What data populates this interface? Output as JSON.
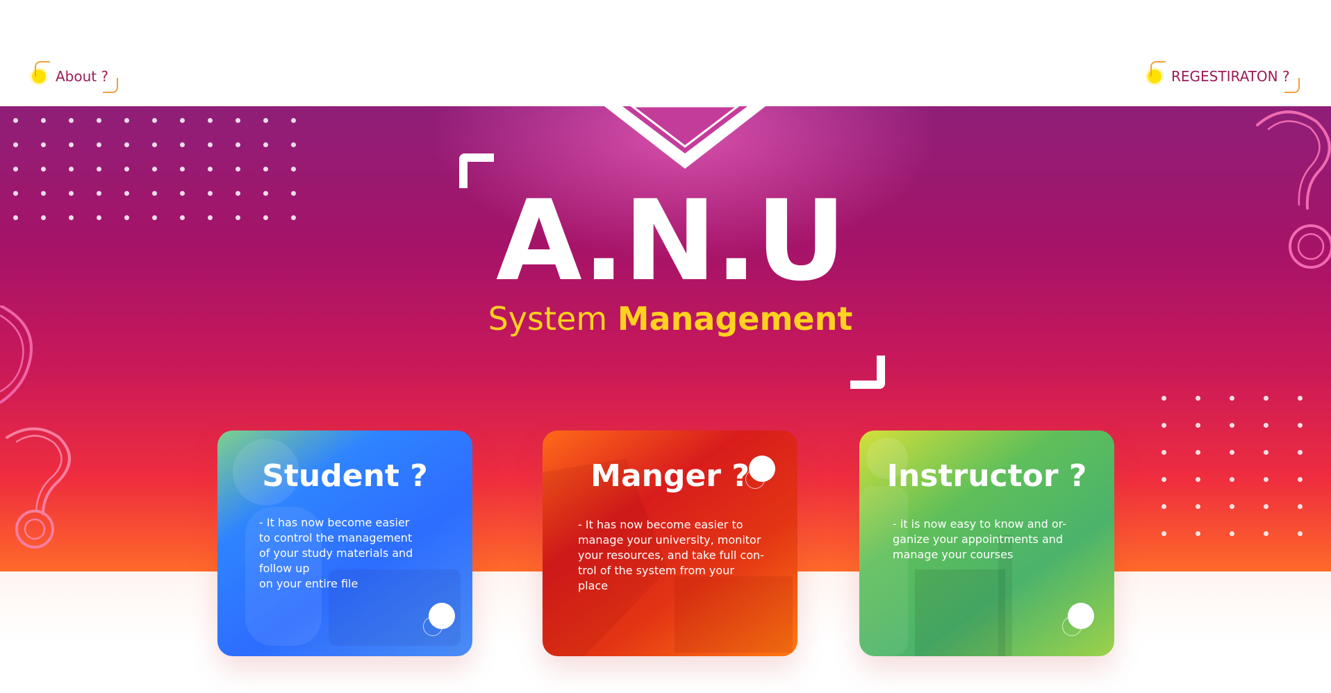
{
  "nav": {
    "about_label": "About ?",
    "registration_label": "REGESTIRATON ?"
  },
  "hero": {
    "title": "A.N.U",
    "subtitle_light": "System ",
    "subtitle_bold": "Management"
  },
  "cards": [
    {
      "title": "Student ?",
      "text": "- It has now become easier\nto control the management\nof your study materials and\nfollow up\non your entire file"
    },
    {
      "title": "Manger ?",
      "text": "- It has now become easier to\nmanage your university, monitor\nyour resources, and take full con-\ntrol of the system from your\nplace"
    },
    {
      "title": "Instructor ?",
      "text": "- it is now easy to know and or-\nganize your appointments and\nmanage your courses"
    }
  ],
  "colors": {
    "accent_yellow": "#ffd21f",
    "nav_text": "#9c1a55",
    "hero_top": "#8f1f78",
    "hero_bottom": "#ff6a2a",
    "student_card": "#2d6dff",
    "manager_card": "#d81c1c",
    "instructor_card": "#4bb36b"
  }
}
